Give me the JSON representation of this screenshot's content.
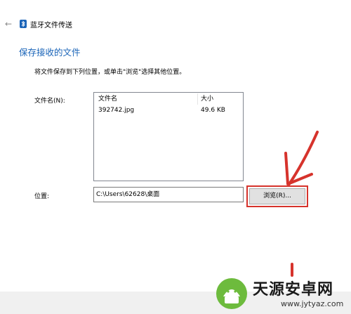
{
  "window": {
    "back_icon": "back-arrow-icon",
    "app_icon": "bluetooth-icon",
    "title": "蓝牙文件传送"
  },
  "page": {
    "heading": "保存接收的文件",
    "instruction": "将文件保存到下列位置，或单击\"浏览\"选择其他位置。",
    "filename_label": "文件名(N):",
    "file_table": {
      "columns": [
        "文件名",
        "大小"
      ],
      "rows": [
        {
          "name": "392742.jpg",
          "size": "49.6 KB"
        }
      ]
    },
    "location_label": "位置:",
    "location_value": "C:\\Users\\62628\\桌面",
    "browse_button": "浏览(R)..."
  },
  "annotation": {
    "color": "#d6332c",
    "shape": "red arrow pointing at browse button"
  },
  "watermark": {
    "title": "天源安卓网",
    "url": "www.jytyaz.com"
  }
}
